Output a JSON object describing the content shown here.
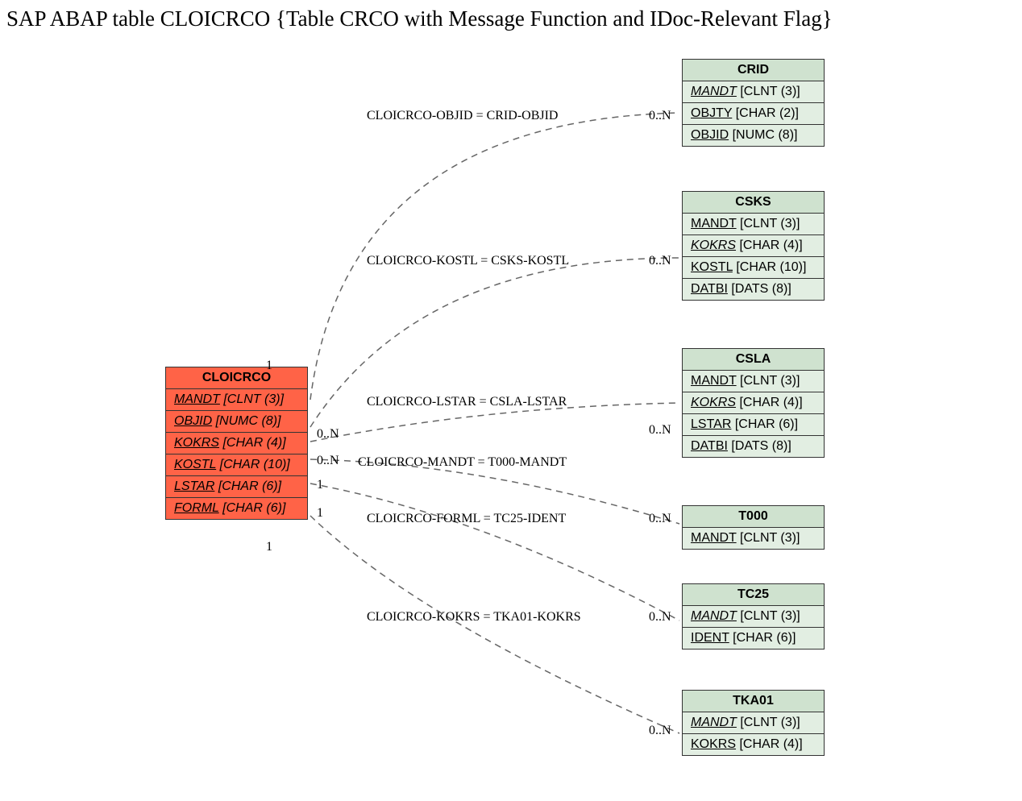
{
  "title": "SAP ABAP table CLOICRCO {Table CRCO with Message Function and IDoc-Relevant Flag}",
  "main": {
    "name": "CLOICRCO",
    "fields": [
      {
        "name": "MANDT",
        "type": "[CLNT (3)]"
      },
      {
        "name": "OBJID",
        "type": "[NUMC (8)]"
      },
      {
        "name": "KOKRS",
        "type": "[CHAR (4)]"
      },
      {
        "name": "KOSTL",
        "type": "[CHAR (10)]"
      },
      {
        "name": "LSTAR",
        "type": "[CHAR (6)]"
      },
      {
        "name": "FORML",
        "type": "[CHAR (6)]"
      }
    ]
  },
  "rel": {
    "crid": {
      "name": "CRID",
      "fields": [
        {
          "name": "MANDT",
          "type": "[CLNT (3)]",
          "italic": true
        },
        {
          "name": "OBJTY",
          "type": "[CHAR (2)]"
        },
        {
          "name": "OBJID",
          "type": "[NUMC (8)]"
        }
      ]
    },
    "csks": {
      "name": "CSKS",
      "fields": [
        {
          "name": "MANDT",
          "type": "[CLNT (3)]"
        },
        {
          "name": "KOKRS",
          "type": "[CHAR (4)]",
          "italic": true
        },
        {
          "name": "KOSTL",
          "type": "[CHAR (10)]"
        },
        {
          "name": "DATBI",
          "type": "[DATS (8)]"
        }
      ]
    },
    "csla": {
      "name": "CSLA",
      "fields": [
        {
          "name": "MANDT",
          "type": "[CLNT (3)]"
        },
        {
          "name": "KOKRS",
          "type": "[CHAR (4)]",
          "italic": true
        },
        {
          "name": "LSTAR",
          "type": "[CHAR (6)]"
        },
        {
          "name": "DATBI",
          "type": "[DATS (8)]"
        }
      ]
    },
    "t000": {
      "name": "T000",
      "fields": [
        {
          "name": "MANDT",
          "type": "[CLNT (3)]"
        }
      ]
    },
    "tc25": {
      "name": "TC25",
      "fields": [
        {
          "name": "MANDT",
          "type": "[CLNT (3)]",
          "italic": true
        },
        {
          "name": "IDENT",
          "type": "[CHAR (6)]"
        }
      ]
    },
    "tka01": {
      "name": "TKA01",
      "fields": [
        {
          "name": "MANDT",
          "type": "[CLNT (3)]",
          "italic": true
        },
        {
          "name": "KOKRS",
          "type": "[CHAR (4)]"
        }
      ]
    }
  },
  "edges": {
    "e1": {
      "label": "CLOICRCO-OBJID = CRID-OBJID",
      "left": "1",
      "right": "0..N"
    },
    "e2": {
      "label": "CLOICRCO-KOSTL = CSKS-KOSTL",
      "left": "",
      "right": "0..N"
    },
    "e3": {
      "label": "CLOICRCO-LSTAR = CSLA-LSTAR",
      "left": "0..N",
      "right": "0..N"
    },
    "e4": {
      "label": "CLOICRCO-MANDT = T000-MANDT",
      "left": "0..N",
      "right": ""
    },
    "e5": {
      "label": "CLOICRCO-FORML = TC25-IDENT",
      "left": "1",
      "right": "0..N"
    },
    "e6": {
      "label": "CLOICRCO-KOKRS = TKA01-KOKRS",
      "left": "1",
      "right": "0..N"
    },
    "e7": {
      "label": "",
      "left": "1",
      "right": "0..N"
    }
  }
}
